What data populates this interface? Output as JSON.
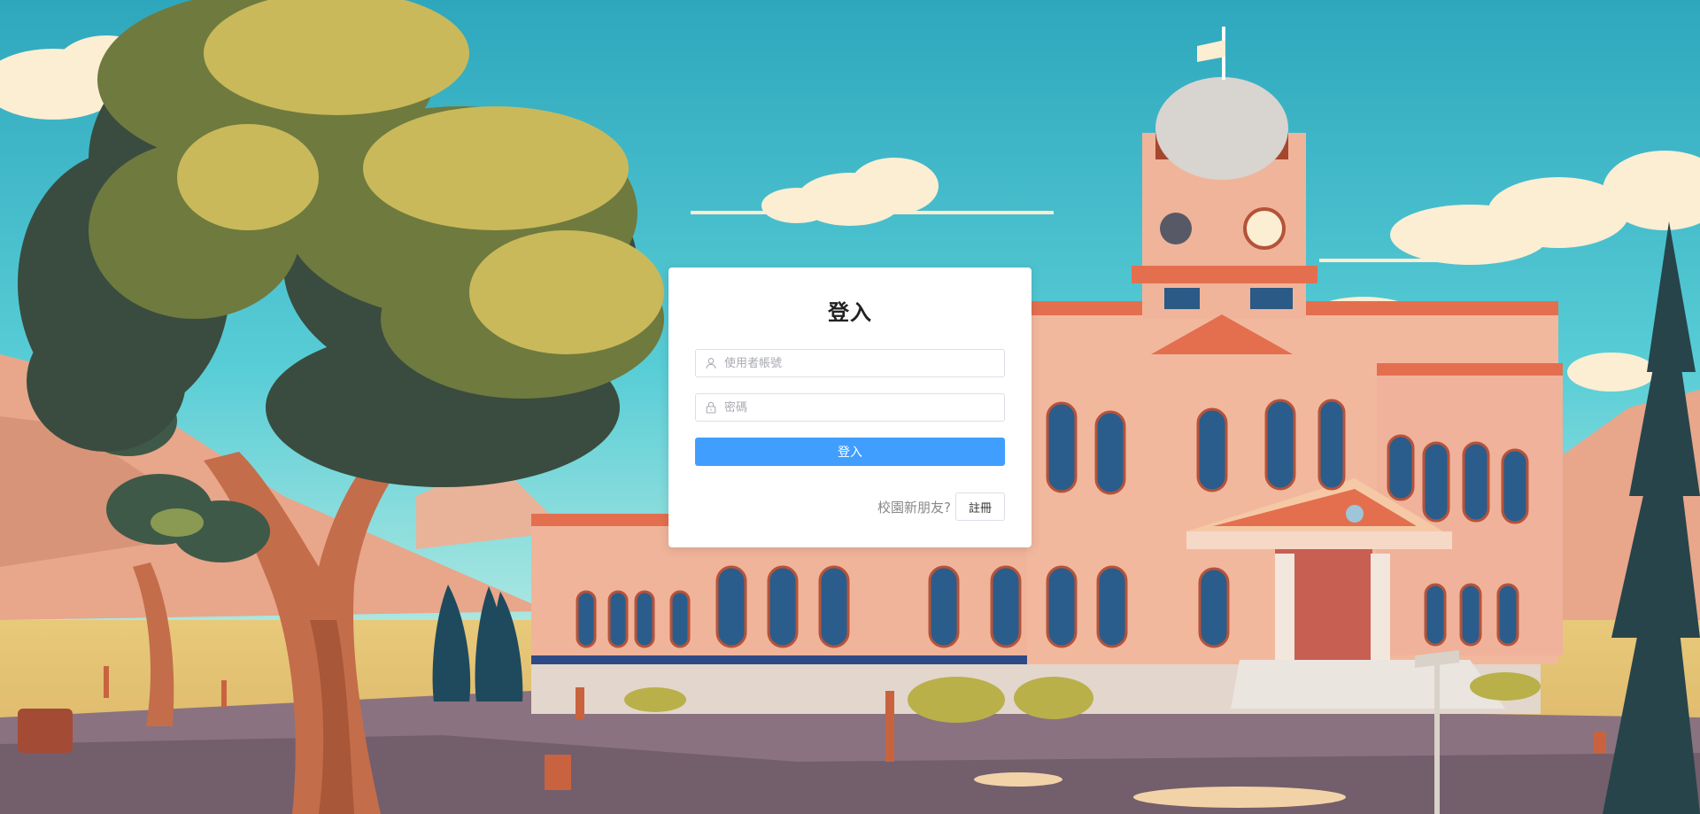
{
  "login_card": {
    "title": "登入",
    "username": {
      "placeholder": "使用者帳號",
      "value": "",
      "icon": "user-icon"
    },
    "password": {
      "placeholder": "密碼",
      "value": "",
      "icon": "lock-icon"
    },
    "submit_label": "登入",
    "register_prompt": "校園新朋友?",
    "register_label": "註冊"
  },
  "colors": {
    "primary": "#409eff",
    "sky": "#4fc3d4",
    "building": "#f0b49a"
  }
}
